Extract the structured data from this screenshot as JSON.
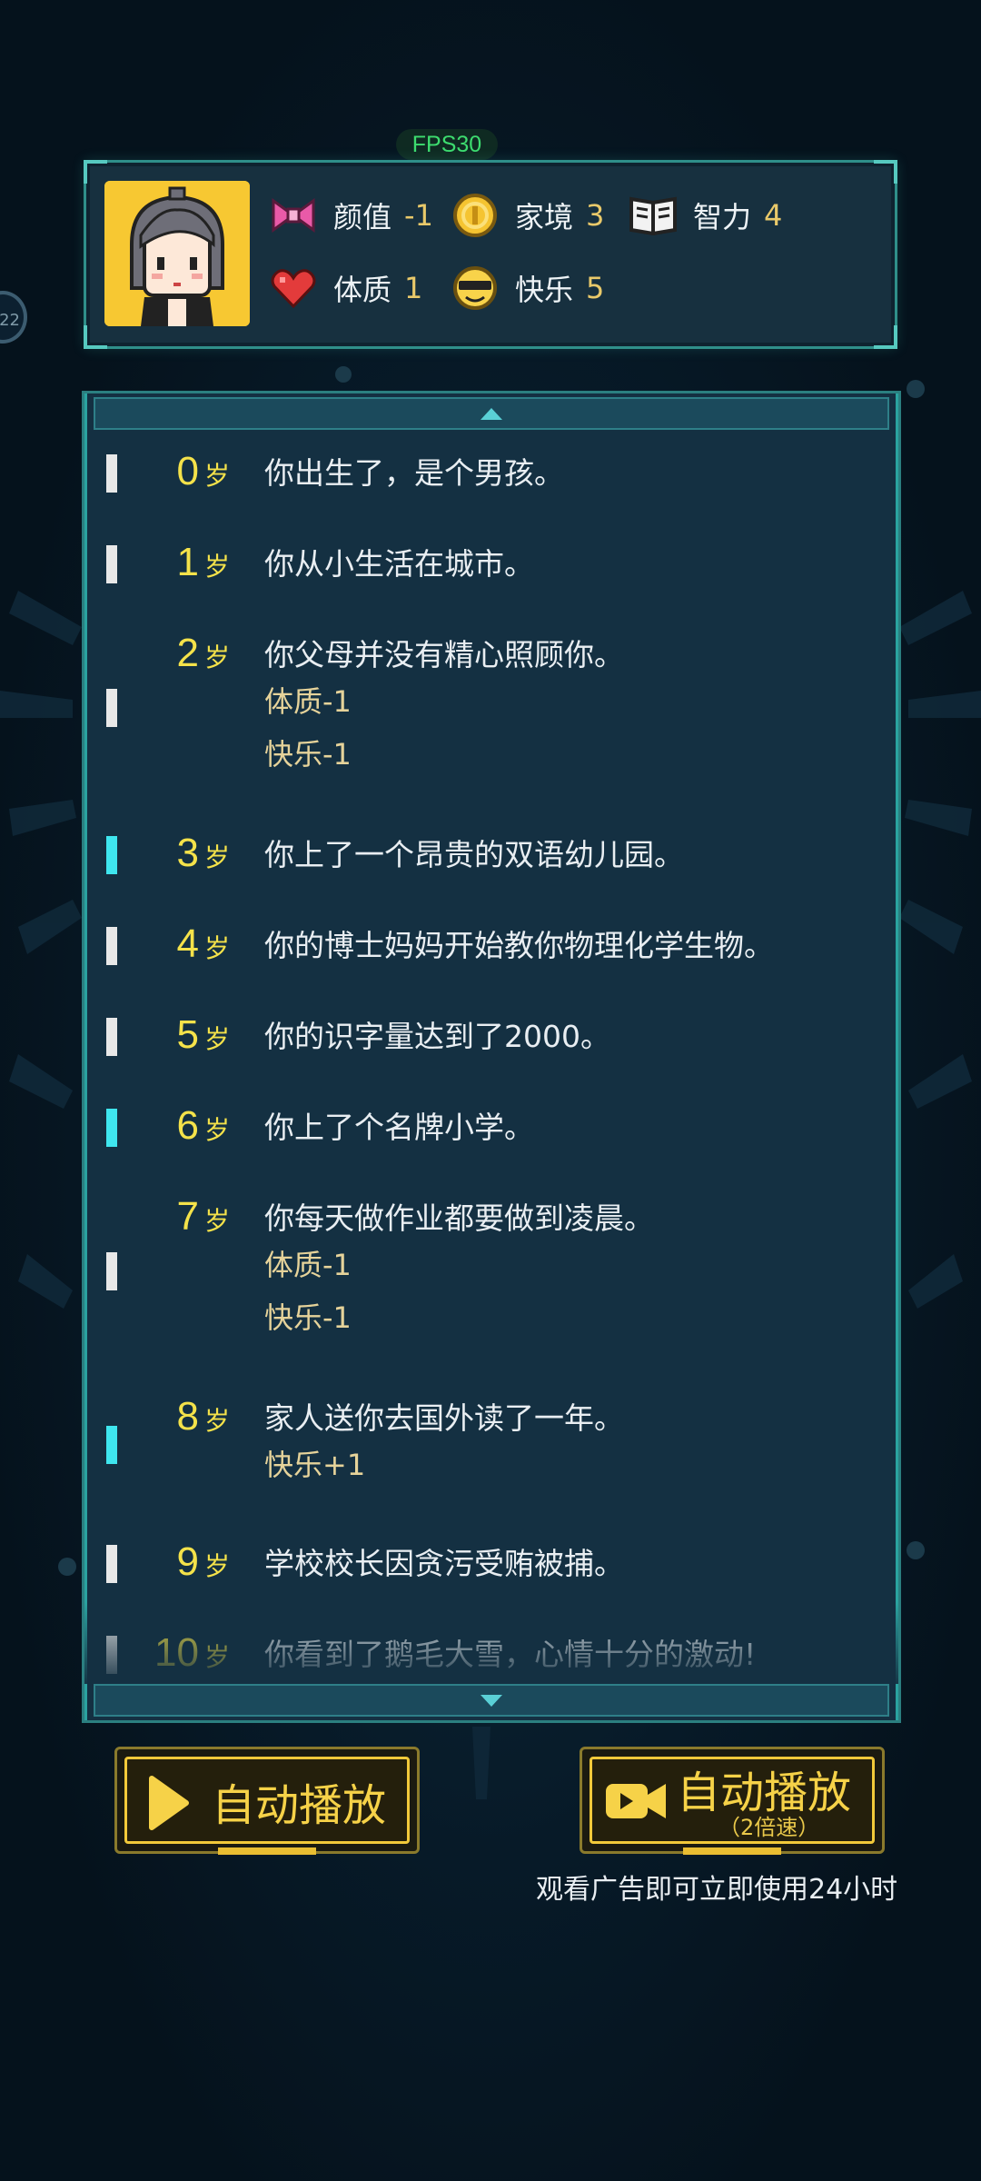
{
  "fps_label": "FPS30",
  "side_badge": "22",
  "stats": {
    "appearance": {
      "label": "颜值",
      "value": "-1",
      "icon": "bow-icon"
    },
    "family": {
      "label": "家境",
      "value": "3",
      "icon": "coin-icon"
    },
    "intelligence": {
      "label": "智力",
      "value": "4",
      "icon": "book-icon"
    },
    "constitution": {
      "label": "体质",
      "value": "1",
      "icon": "heart-icon"
    },
    "happiness": {
      "label": "快乐",
      "value": "5",
      "icon": "sunglasses-face-icon"
    }
  },
  "age_unit": "岁",
  "entries": [
    {
      "age": "0",
      "text": "你出生了，是个男孩。",
      "effects": [],
      "marker": "white"
    },
    {
      "age": "1",
      "text": "你从小生活在城市。",
      "effects": [],
      "marker": "white"
    },
    {
      "age": "2",
      "text": "你父母并没有精心照顾你。",
      "effects": [
        "体质-1",
        "快乐-1"
      ],
      "marker": "white"
    },
    {
      "age": "3",
      "text": "你上了一个昂贵的双语幼儿园。",
      "effects": [],
      "marker": "cyan"
    },
    {
      "age": "4",
      "text": "你的博士妈妈开始教你物理化学生物。",
      "effects": [],
      "marker": "white"
    },
    {
      "age": "5",
      "text": "你的识字量达到了2000。",
      "effects": [],
      "marker": "white"
    },
    {
      "age": "6",
      "text": "你上了个名牌小学。",
      "effects": [],
      "marker": "cyan"
    },
    {
      "age": "7",
      "text": "你每天做作业都要做到凌晨。",
      "effects": [
        "体质-1",
        "快乐-1"
      ],
      "marker": "white"
    },
    {
      "age": "8",
      "text": "家人送你去国外读了一年。",
      "effects": [
        "快乐+1"
      ],
      "marker": "cyan"
    },
    {
      "age": "9",
      "text": "学校校长因贪污受贿被捕。",
      "effects": [],
      "marker": "white"
    },
    {
      "age": "10",
      "text": "你看到了鹅毛大雪，心情十分的激动!",
      "effects": [],
      "marker": "white"
    }
  ],
  "buttons": {
    "auto_play": {
      "label": "自动播放"
    },
    "auto_play_fast": {
      "label": "自动播放",
      "sub": "（2倍速）"
    }
  },
  "ad_note": "观看广告即可立即使用24小时",
  "colors": {
    "accent_yellow": "#f4e24a",
    "marker_white": "#e8e8e8",
    "marker_cyan": "#3fe6ef",
    "panel_border": "#2b7f80"
  }
}
